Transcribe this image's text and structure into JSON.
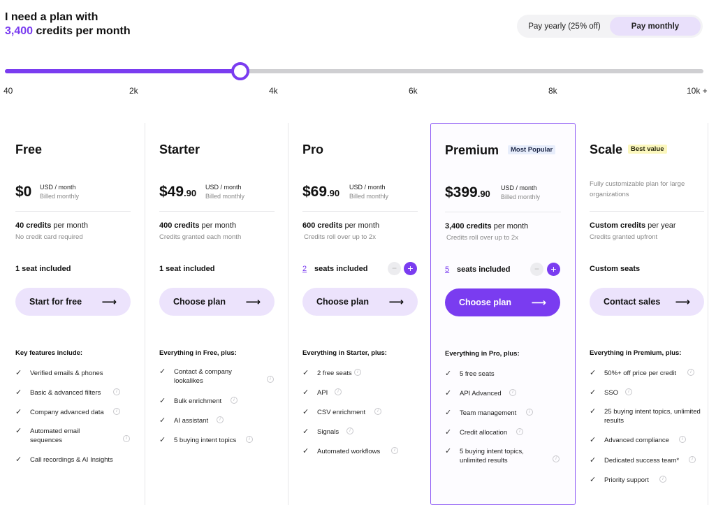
{
  "header": {
    "prefix": "I need a plan with",
    "credits_amount": "3,400",
    "suffix": "credits per month"
  },
  "billing": {
    "yearly_label": "Pay yearly (25% off)",
    "monthly_label": "Pay monthly",
    "selected": "monthly"
  },
  "slider": {
    "value": 3400,
    "min": 40,
    "max": 10000,
    "ticks": [
      "40",
      "2k",
      "4k",
      "6k",
      "8k",
      "10k +"
    ]
  },
  "colors": {
    "accent": "#7a3cf0",
    "accent_soft": "#ece3fc",
    "muted_text": "#888888"
  },
  "plans": [
    {
      "name": "Free",
      "price_main": "$0",
      "price_cents": "",
      "price_unit": "USD / month",
      "billing": "Billed monthly",
      "credits_amount": "40 credits",
      "credits_suffix": " per month",
      "credits_note": "No credit card required",
      "seats_label": "1 seat included",
      "cta": "Start for free",
      "features_heading": "Key features include:",
      "features": [
        "Verified emails & phones",
        "Basic & advanced filters",
        "Company advanced data",
        "Automated email sequences",
        "Call recordings & AI Insights"
      ]
    },
    {
      "name": "Starter",
      "price_main": "$49",
      "price_cents": ".90",
      "price_unit": "USD / month",
      "billing": "Billed monthly",
      "credits_amount": "400 credits",
      "credits_suffix": " per month",
      "credits_note": "Credits granted each month",
      "seats_label": "1 seat included",
      "cta": "Choose plan",
      "features_heading": "Everything in Free, plus:",
      "features": [
        "Contact & company lookalikes",
        "Bulk enrichment",
        "AI assistant",
        "5 buying intent topics"
      ]
    },
    {
      "name": "Pro",
      "price_main": "$69",
      "price_cents": ".90",
      "price_unit": "USD / month",
      "billing": "Billed monthly",
      "credits_amount": "600 credits",
      "credits_suffix": " per month",
      "credits_note": "Credits roll over up to 2x",
      "seat_count": "2",
      "seats_label": "seats included",
      "cta": "Choose plan",
      "features_heading": "Everything in Starter, plus:",
      "features": [
        "2 free seats",
        "API",
        "CSV enrichment",
        "Signals",
        "Automated workflows"
      ]
    },
    {
      "name": "Premium",
      "badge": "Most Popular",
      "price_main": "$399",
      "price_cents": ".90",
      "price_unit": "USD / month",
      "billing": "Billed monthly",
      "credits_amount": "3,400 credits",
      "credits_suffix": " per month",
      "credits_note": "Credits roll over up to 2x",
      "seat_count": "5",
      "seats_label": "seats included",
      "cta": "Choose plan",
      "features_heading": "Everything in Pro, plus:",
      "features": [
        "5 free seats",
        "API Advanced",
        "Team management",
        "Credit allocation",
        "5 buying intent topics, unlimited results"
      ]
    },
    {
      "name": "Scale",
      "badge": "Best value",
      "description": "Fully customizable plan for large organizations",
      "credits_amount": "Custom credits",
      "credits_suffix": " per year",
      "credits_note": "Credits granted upfront",
      "seats_label": "Custom seats",
      "cta": "Contact sales",
      "features_heading": "Everything in Premium, plus:",
      "features": [
        "50%+ off price per credit",
        "SSO",
        "25 buying intent topics, unlimited results",
        "Advanced compliance",
        "Dedicated success team*",
        "Priority support"
      ]
    }
  ]
}
